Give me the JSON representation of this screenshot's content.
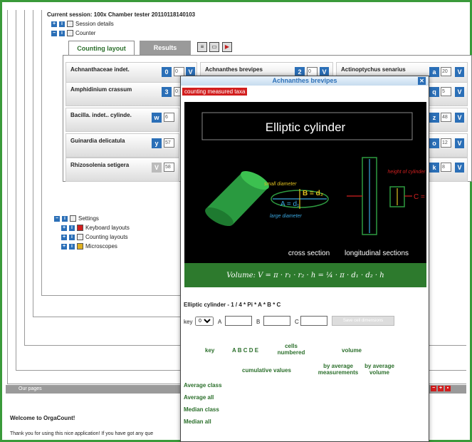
{
  "session": {
    "title": "Current session: 100x Chamber tester 20110118140103",
    "details_label": "Session details",
    "counter_label": "Counter"
  },
  "tabs": [
    {
      "label": "Counting layout"
    },
    {
      "label": "Results"
    }
  ],
  "cells": [
    {
      "name": "Achnanthaceae indet.",
      "key": "0",
      "count": "0"
    },
    {
      "name": "Achnanthes brevipes",
      "key": "2",
      "count": "0"
    },
    {
      "name": "Actinoptychus senarius",
      "key": "a",
      "count": "20"
    },
    {
      "name": "Amphidinium crassum",
      "key": "3",
      "count": "0"
    },
    {
      "name": "",
      "key": "q",
      "count": "5"
    },
    {
      "name": "Bacilla. indet.. cylinde.",
      "key": "w",
      "count": "6"
    },
    {
      "name": "",
      "key": "z",
      "count": "48"
    },
    {
      "name": "Guinardia delicatula",
      "key": "y",
      "count": "57"
    },
    {
      "name": "",
      "key": "o",
      "count": "12"
    },
    {
      "name": "Rhizosolenia setigera",
      "key": "V",
      "count": "58"
    },
    {
      "name": "",
      "key": "k",
      "count": "8"
    }
  ],
  "v_label": "V",
  "settings": {
    "label": "Settings",
    "items": [
      "Keyboard layouts",
      "Counting layouts",
      "Microscopes"
    ]
  },
  "our_pages": "Our pages",
  "welcome": "Welcome to OrgaCount!",
  "thanks": "Thank you for using this nice application! If you have got any que",
  "popup": {
    "title": "Achnanthes brevipes",
    "subtitle": "counting measured taxa",
    "shape_title": "Elliptic cylinder",
    "small_diameter": "small diameter",
    "b_label": "B = d₂",
    "a_label": "A = d₁",
    "large_diameter": "large diameter",
    "height_label": "height of cylinder",
    "c_label": "C = h",
    "cross_section": "cross section",
    "longitudinal": "longitudinal  sections",
    "formula": "Volume: V = π · r₁ · r₂ · h = ¼ · π · d₁ · d₂ · h",
    "formula_text": "Elliptic cylinder - 1 / 4 * Pi * A * B * C",
    "key_label": "key",
    "key_value": "0",
    "a": "A",
    "b": "B",
    "c": "C",
    "save_button": "Save cell dimensions",
    "headers": {
      "key": "key",
      "letters": "A  B  C  D  E",
      "cells_numbered": "cells numbered",
      "volume": "volume",
      "cumulative": "cumulative values",
      "by_avg_meas": "by average measurements",
      "by_avg_vol": "by average volume"
    },
    "rows": [
      "Average class",
      "Average all",
      "Median class",
      "Median all"
    ]
  }
}
